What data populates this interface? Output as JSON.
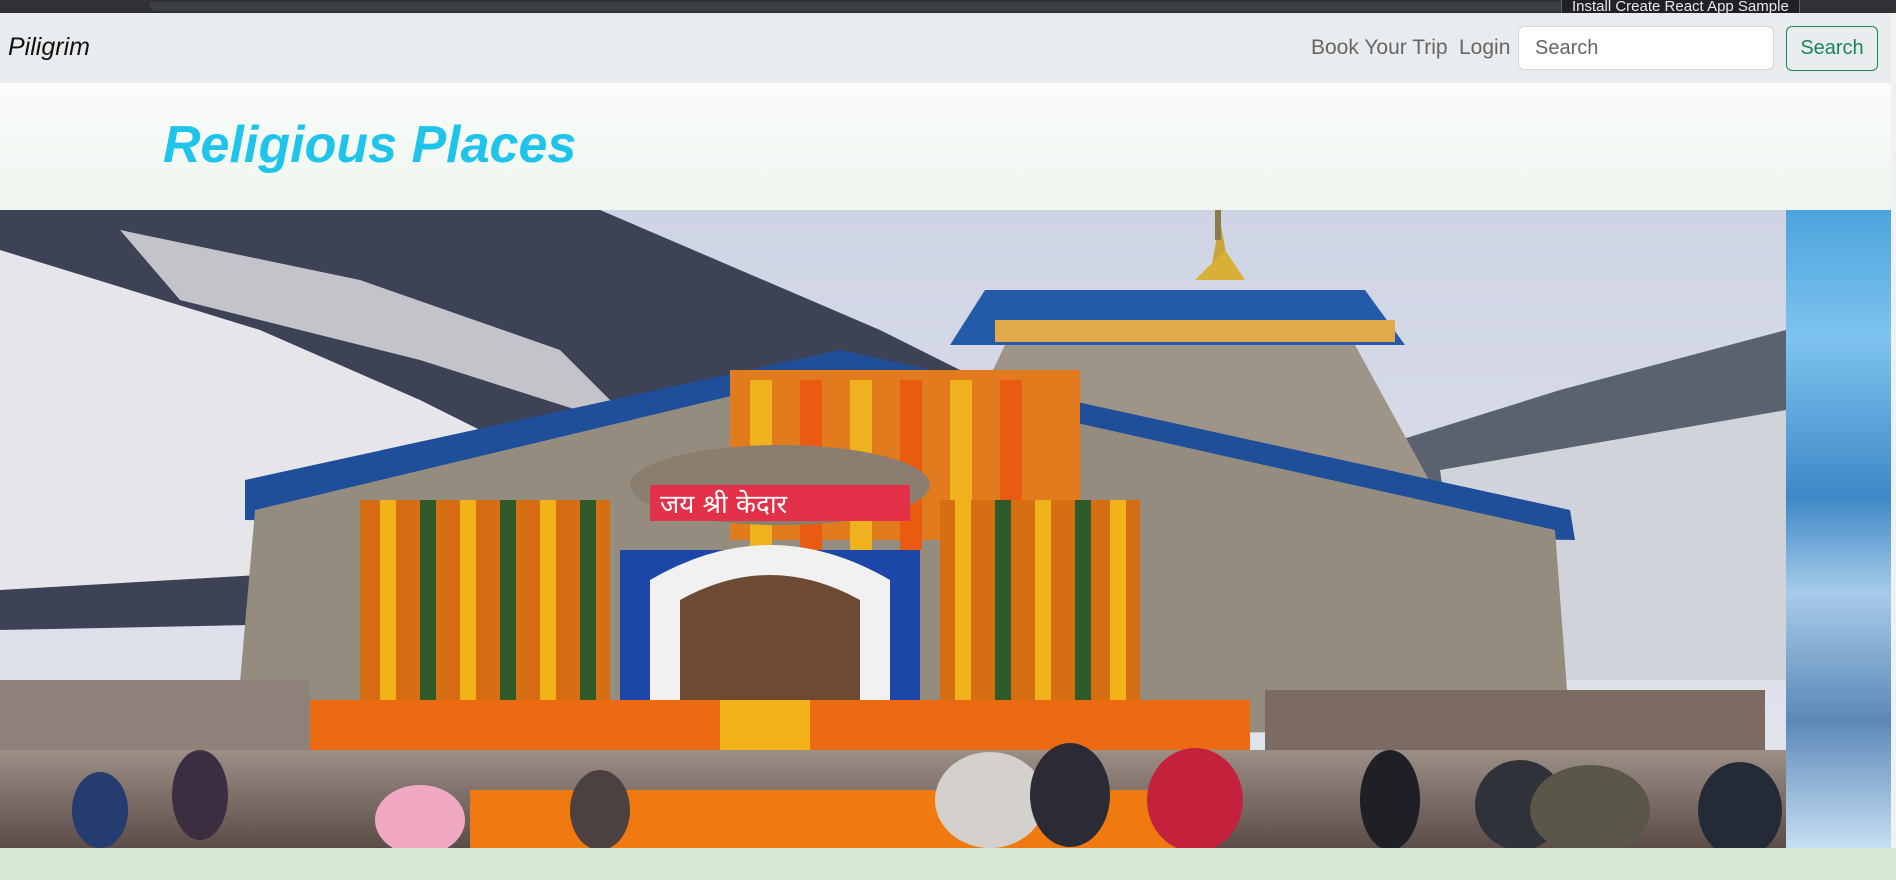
{
  "tooltip": "Install Create React App Sample",
  "navbar": {
    "brand": "Piligrim",
    "links": [
      "Book Your Trip",
      "Login"
    ],
    "search_placeholder": "Search",
    "search_button": "Search"
  },
  "page": {
    "title": "Religious Places"
  },
  "carousel": {
    "active_slide_sign_text": "जय श्री केदार"
  }
}
